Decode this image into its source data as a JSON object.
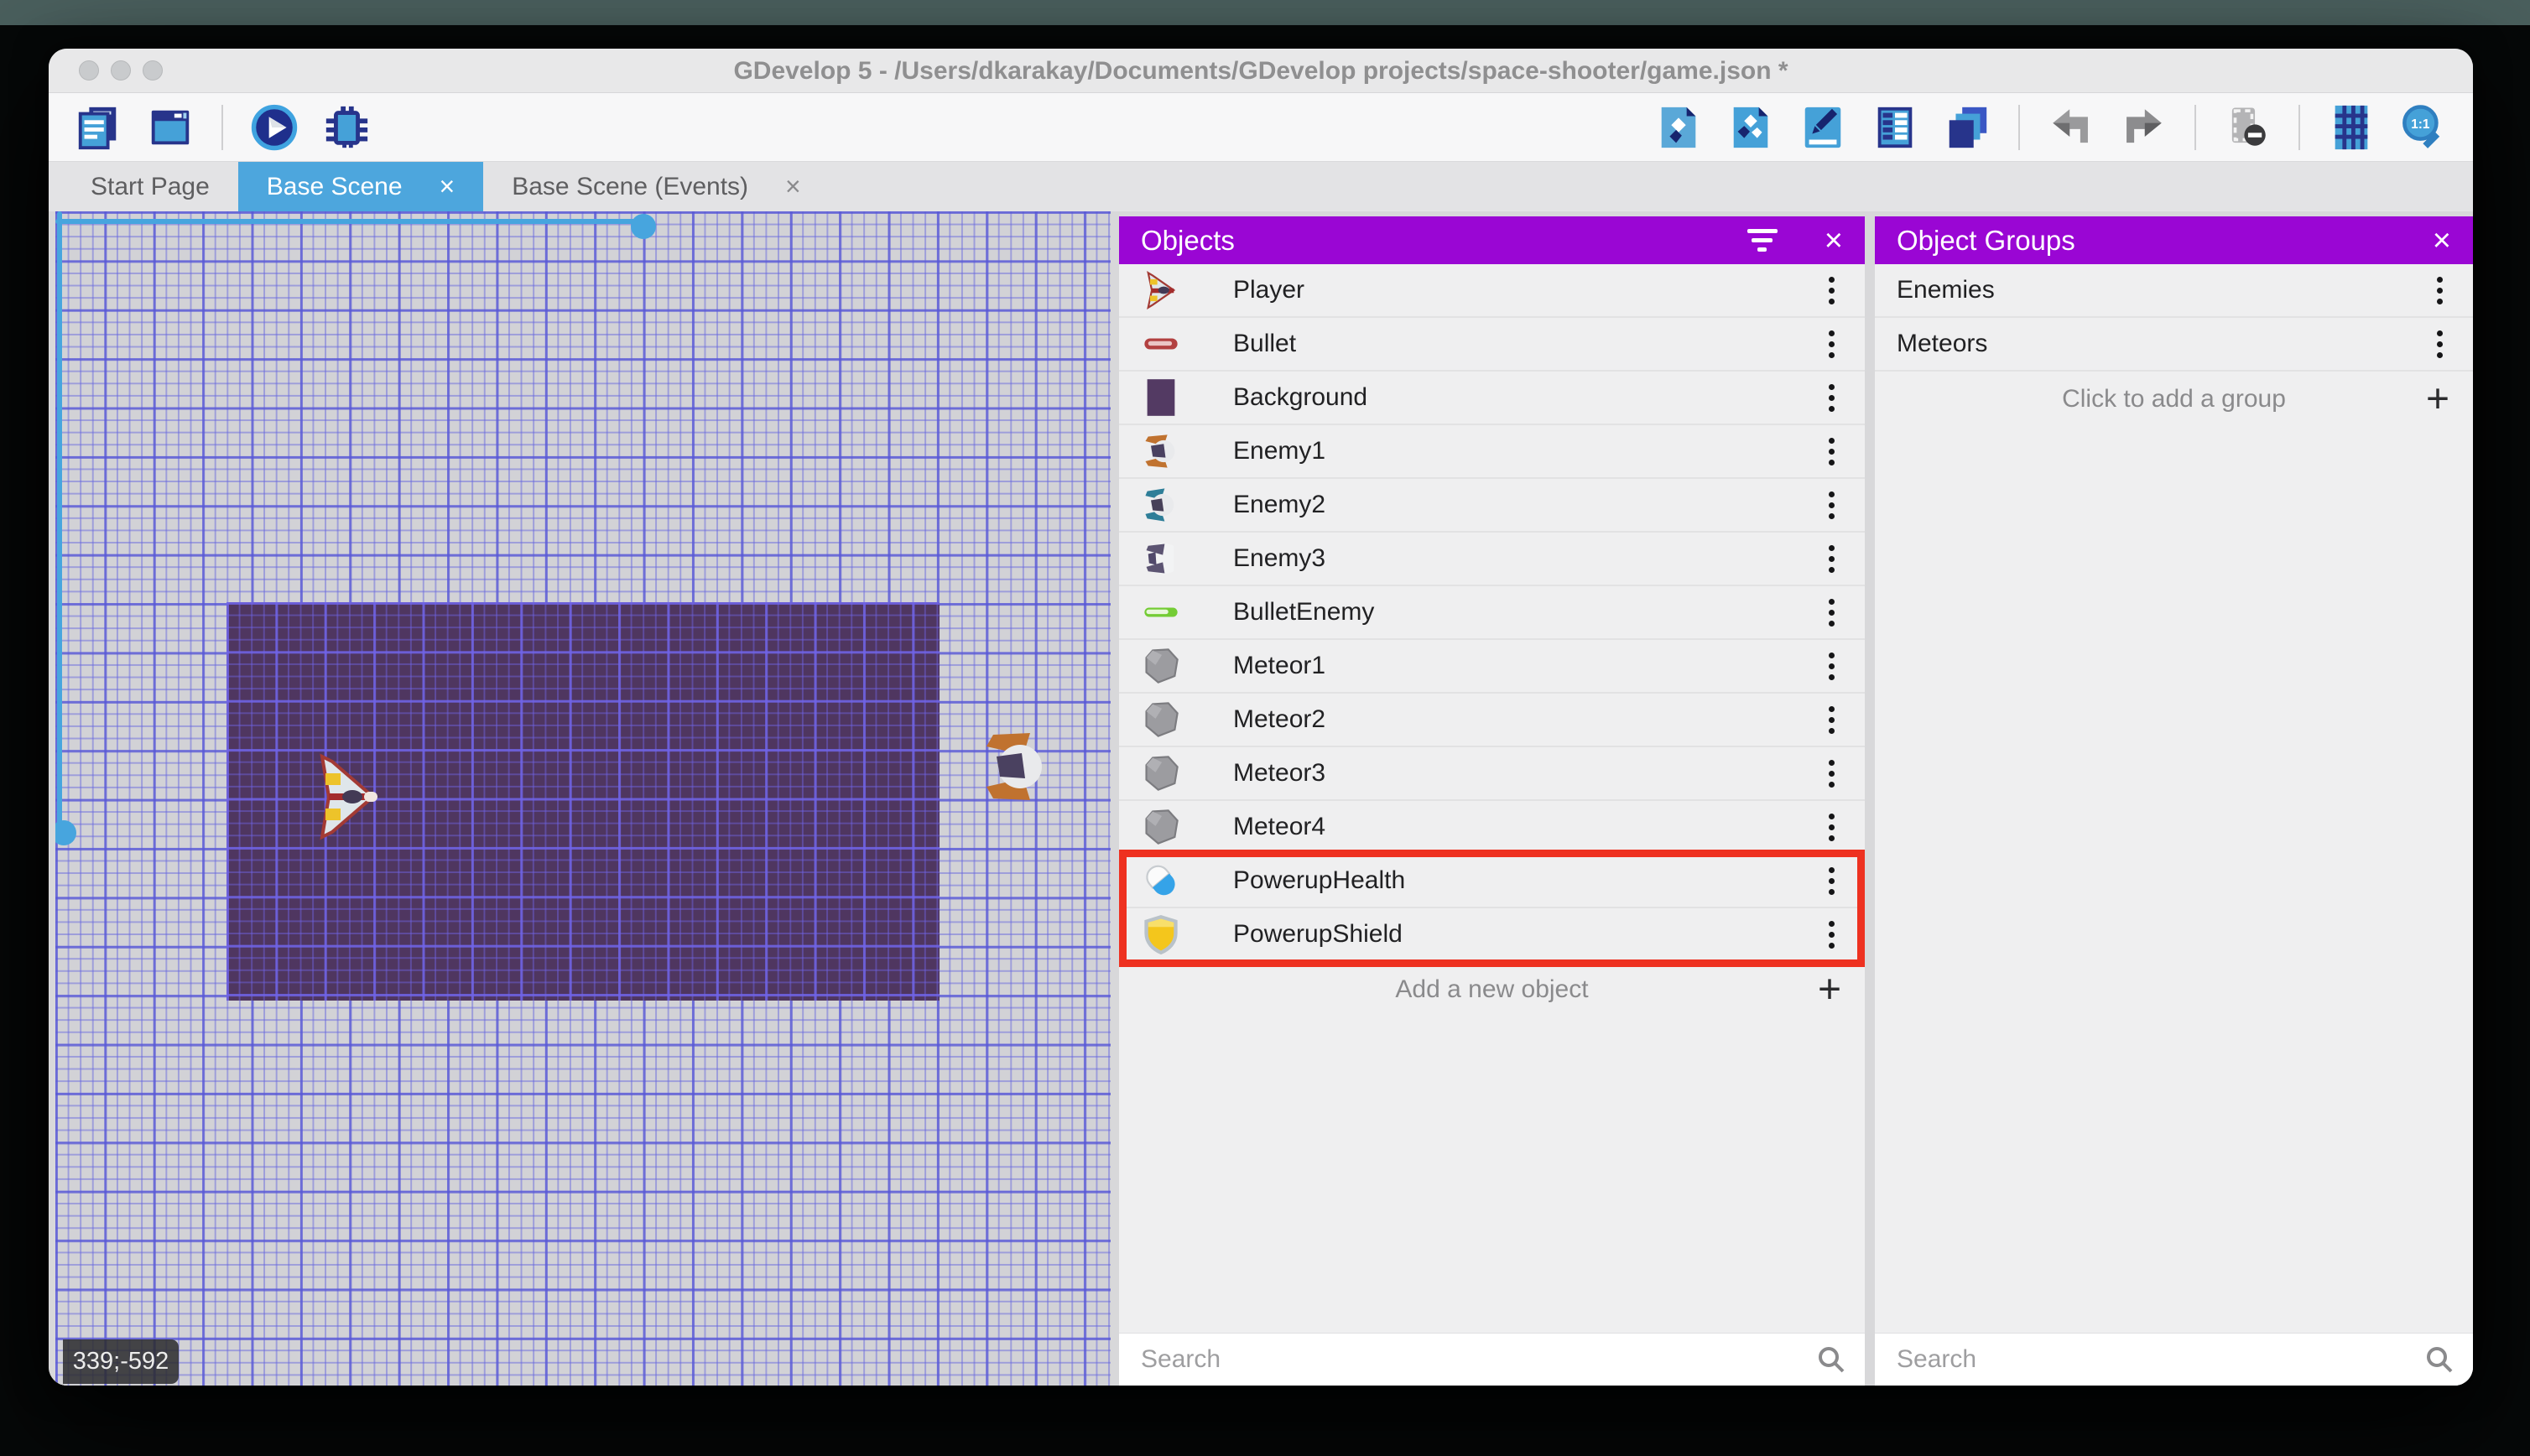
{
  "window": {
    "title": "GDevelop 5 - /Users/dkarakay/Documents/GDevelop projects/space-shooter/game.json *"
  },
  "glyphs": {
    "close": "×",
    "plus": "+"
  },
  "tabs": [
    {
      "label": "Start Page",
      "active": false,
      "closable": false
    },
    {
      "label": "Base Scene",
      "active": true,
      "closable": true
    },
    {
      "label": "Base Scene (Events)",
      "active": false,
      "closable": true
    }
  ],
  "toolbar": {
    "left_icons": [
      "project-manager",
      "preview-window",
      "play-preview",
      "debug"
    ],
    "right_icons": [
      "objects-editor",
      "object-groups-editor",
      "properties",
      "instances-list",
      "layers",
      "undo",
      "redo",
      "toggle-window-mask",
      "toggle-grid",
      "zoom-to-fit"
    ],
    "zoom_fit_label": "1:1"
  },
  "canvas": {
    "coordinates": "339;-592"
  },
  "objects_panel": {
    "title": "Objects",
    "search_placeholder": "Search",
    "add_button_label": "Add a new object",
    "items": [
      {
        "name": "Player",
        "icon": "player"
      },
      {
        "name": "Bullet",
        "icon": "bullet"
      },
      {
        "name": "Background",
        "icon": "background"
      },
      {
        "name": "Enemy1",
        "icon": "enemy1"
      },
      {
        "name": "Enemy2",
        "icon": "enemy2"
      },
      {
        "name": "Enemy3",
        "icon": "enemy3"
      },
      {
        "name": "BulletEnemy",
        "icon": "bullet-enemy"
      },
      {
        "name": "Meteor1",
        "icon": "meteor"
      },
      {
        "name": "Meteor2",
        "icon": "meteor"
      },
      {
        "name": "Meteor3",
        "icon": "meteor"
      },
      {
        "name": "Meteor4",
        "icon": "meteor"
      },
      {
        "name": "PowerupHealth",
        "icon": "powerup-health",
        "highlighted": true
      },
      {
        "name": "PowerupShield",
        "icon": "powerup-shield",
        "highlighted": true
      }
    ]
  },
  "object_groups_panel": {
    "title": "Object Groups",
    "search_placeholder": "Search",
    "add_button_label": "Click to add a group",
    "items": [
      {
        "name": "Enemies"
      },
      {
        "name": "Meteors"
      }
    ]
  },
  "colors": {
    "accent_blue": "#4da6dd",
    "panel_header_purple": "#9a06d4",
    "highlight_red": "#ee3120",
    "scene_background_purple": "#4f3660"
  }
}
